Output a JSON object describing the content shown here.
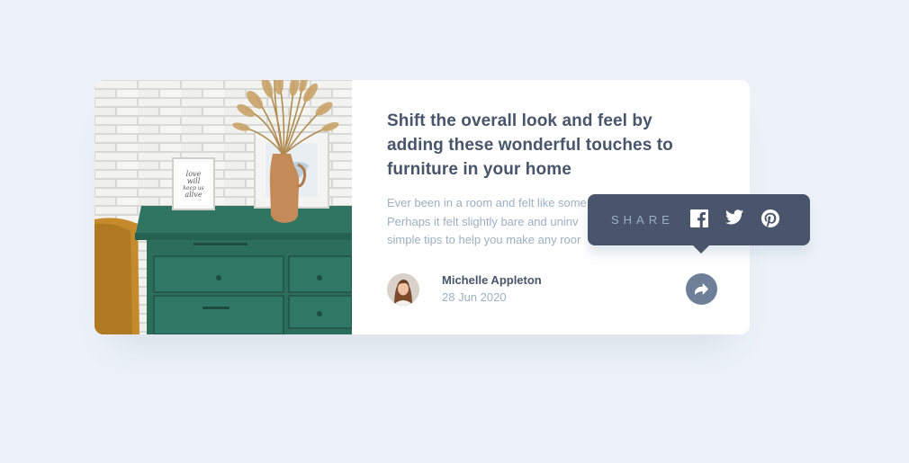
{
  "article": {
    "title": "Shift the overall look and feel by adding these wonderful touches to furniture in your home",
    "excerpt_lines": [
      "Ever been in a room and felt like some",
      "Perhaps it felt slightly bare and uninv",
      "simple tips to help you make any roor"
    ]
  },
  "author": {
    "name": "Michelle Appleton",
    "date": "28 Jun 2020"
  },
  "share": {
    "label": "SHARE",
    "networks": [
      "facebook",
      "twitter",
      "pinterest"
    ]
  },
  "image": {
    "frame_text": [
      "love",
      "will",
      "keep us",
      "alive"
    ]
  },
  "icons": {
    "share_button": "share-arrow-icon",
    "facebook": "facebook-icon",
    "twitter": "twitter-icon",
    "pinterest": "pinterest-icon"
  },
  "colors": {
    "background": "#ecf2f8",
    "title": "#48556a",
    "muted": "#9eafc2",
    "tooltip": "#48556a",
    "share_button": "#6e8098",
    "drawer": "#2c6e5c"
  }
}
